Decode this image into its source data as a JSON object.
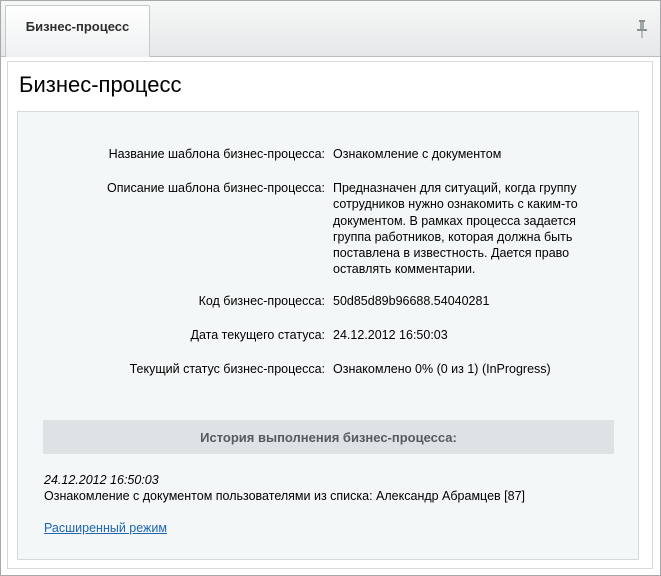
{
  "tab": {
    "label": "Бизнес-процесс"
  },
  "page": {
    "title": "Бизнес-процесс"
  },
  "properties": [
    {
      "label": "Название шаблона бизнес-процесса:",
      "value": "Ознакомление с документом"
    },
    {
      "label": "Описание шаблона бизнес-процесса:",
      "value": "Предназначен для ситуаций, когда группу сотрудников нужно ознакомить с каким-то документом. В рамках процесса задается группа работников, которая должна быть поставлена в известность. Дается право оставлять комментарии."
    },
    {
      "label": "Код бизнес-процесса:",
      "value": "50d85d89b96688.54040281"
    },
    {
      "label": "Дата текущего статуса:",
      "value": "24.12.2012 16:50:03"
    },
    {
      "label": "Текущий статус бизнес-процесса:",
      "value": "Ознакомлено 0% (0 из 1) (InProgress)"
    }
  ],
  "history": {
    "title": "История выполнения бизнес-процесса:",
    "entries": [
      {
        "date": "24.12.2012 16:50:03",
        "text": "Ознакомление с документом пользователями из списка: Александр Абрамцев [87]"
      }
    ]
  },
  "links": {
    "advanced_mode": "Расширенный режим"
  },
  "icons": {
    "pin": "pin-icon"
  },
  "colors": {
    "link": "#2066b0",
    "panel": "#f4f7f8",
    "history_header": "#dde3e5"
  }
}
